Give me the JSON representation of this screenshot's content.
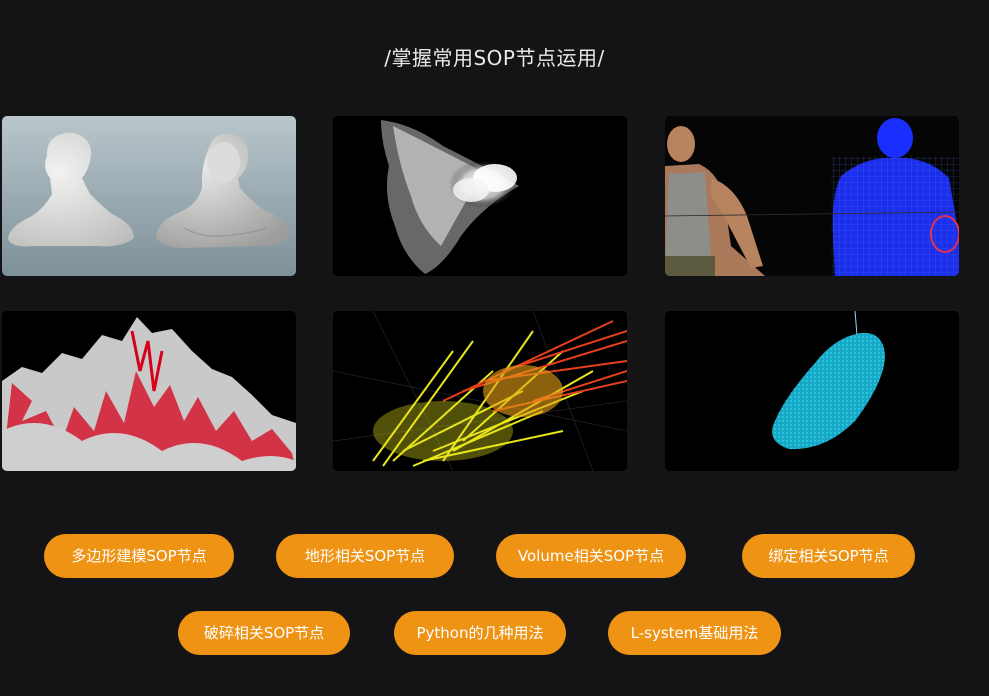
{
  "header": {
    "title": "/掌握常用SOP节点运用/"
  },
  "gallery": {
    "items": [
      {
        "subject": "clay-bust-models"
      },
      {
        "subject": "white-smoke-cloud"
      },
      {
        "subject": "wireframe-character"
      },
      {
        "subject": "terrain-mountains"
      },
      {
        "subject": "particle-streaks"
      },
      {
        "subject": "cyan-point-cloud"
      }
    ]
  },
  "topics": {
    "row1": [
      {
        "label": "多边形建模SOP节点"
      },
      {
        "label": "地形相关SOP节点"
      },
      {
        "label": "Volume相关SOP节点"
      },
      {
        "label": "绑定相关SOP节点"
      }
    ],
    "row2": [
      {
        "label": "破碎相关SOP节点"
      },
      {
        "label": "Python的几种用法"
      },
      {
        "label": "L-system基础用法"
      }
    ]
  },
  "colors": {
    "background": "#141416",
    "accent": "#ee9313",
    "title_text": "#e9e9ea"
  }
}
